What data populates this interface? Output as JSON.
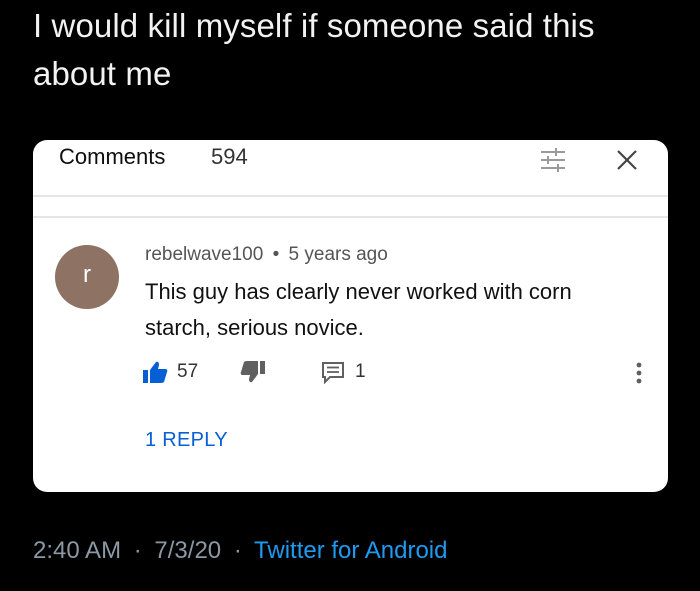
{
  "tweet": {
    "text_line1": "I would kill myself if someone said this",
    "text_line2": "about me",
    "time": "2:40 AM",
    "date": "7/3/20",
    "separator": "·",
    "source": "Twitter for Android"
  },
  "comments_panel": {
    "title": "Comments",
    "count": "594",
    "sort_icon": "sort-icon",
    "close_icon": "close-icon"
  },
  "comment": {
    "avatar_letter": "r",
    "author": "rebelwave100",
    "separator": "•",
    "time_ago": "5 years ago",
    "body_line1": "This guy has clearly never worked with corn",
    "body_line2": "starch, serious novice.",
    "likes": "57",
    "replies_count": "1",
    "replies_link": "1 REPLY",
    "icons": {
      "like": "thumbs-up-icon",
      "dislike": "thumbs-down-icon",
      "reply": "reply-icon",
      "more": "more-vertical-icon"
    }
  },
  "colors": {
    "background": "#000000",
    "card": "#ffffff",
    "avatar": "#8e7264",
    "link_blue": "#065fd4",
    "twitter_blue": "#1d9bf0",
    "meta_gray": "#8b98a5"
  }
}
